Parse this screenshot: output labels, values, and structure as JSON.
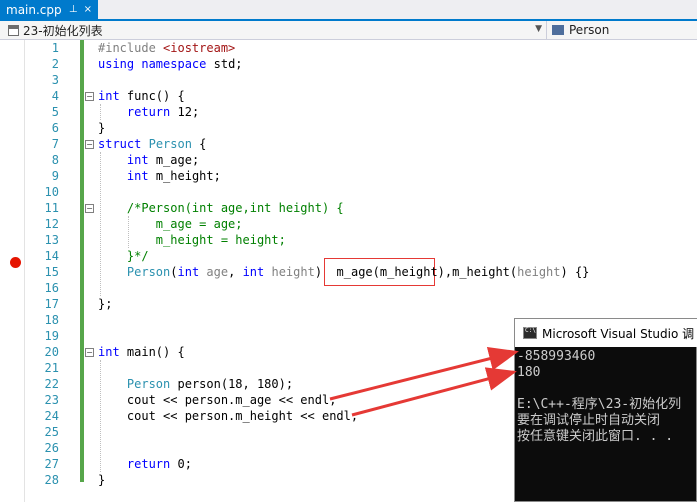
{
  "tab": {
    "title": "main.cpp",
    "pin_icon": "pin-icon",
    "close_glyph": "×"
  },
  "navbar": {
    "project": "23-初始化列表",
    "scope": "Person"
  },
  "code_lines": [
    {
      "n": "1",
      "html": "<span class=\"pp\">#include</span> <span class=\"str\">&lt;iostream&gt;</span>"
    },
    {
      "n": "2",
      "html": "<span class=\"kw\">using</span> <span class=\"kw\">namespace</span> std;"
    },
    {
      "n": "3",
      "html": ""
    },
    {
      "n": "4",
      "html": "<span class=\"kw\">int</span> func() {"
    },
    {
      "n": "5",
      "html": "    <span class=\"kw\">return</span> 12;"
    },
    {
      "n": "6",
      "html": "}"
    },
    {
      "n": "7",
      "html": "<span class=\"kw\">struct</span> <span class=\"ty\">Person</span> {"
    },
    {
      "n": "8",
      "html": "    <span class=\"kw\">int</span> m_age;"
    },
    {
      "n": "9",
      "html": "    <span class=\"kw\">int</span> m_height;"
    },
    {
      "n": "10",
      "html": ""
    },
    {
      "n": "11",
      "html": "    <span class=\"cm\">/*Person(int age,int height) {</span>"
    },
    {
      "n": "12",
      "html": "<span class=\"cm\">        m_age = age;</span>"
    },
    {
      "n": "13",
      "html": "<span class=\"cm\">        m_height = height;</span>"
    },
    {
      "n": "14",
      "html": "<span class=\"cm\">    }*/</span>"
    },
    {
      "n": "15",
      "html": "    <span class=\"ty\">Person</span>(<span class=\"kw\">int</span> <span class=\"pa\">age</span>, <span class=\"kw\">int</span> <span class=\"pa\">height</span>)  m_age(m_height),m_height(<span class=\"pa\">height</span>) {}"
    },
    {
      "n": "16",
      "html": ""
    },
    {
      "n": "17",
      "html": "};"
    },
    {
      "n": "18",
      "html": ""
    },
    {
      "n": "19",
      "html": ""
    },
    {
      "n": "20",
      "html": "<span class=\"kw\">int</span> main() {"
    },
    {
      "n": "21",
      "html": ""
    },
    {
      "n": "22",
      "html": "    <span class=\"ty\">Person</span> person(18, 180);"
    },
    {
      "n": "23",
      "html": "    cout &lt;&lt; person.m_age &lt;&lt; endl;"
    },
    {
      "n": "24",
      "html": "    cout &lt;&lt; person.m_height &lt;&lt; endl;"
    },
    {
      "n": "25",
      "html": ""
    },
    {
      "n": "26",
      "html": ""
    },
    {
      "n": "27",
      "html": "    <span class=\"kw\">return</span> 0;"
    },
    {
      "n": "28",
      "html": "}"
    }
  ],
  "folds": [
    "4",
    "7",
    "11",
    "20"
  ],
  "breakpoint_line": "12",
  "console": {
    "title": "Microsoft Visual Studio 调",
    "lines": [
      "-858993460",
      "180",
      "",
      "E:\\C++-程序\\23-初始化列",
      "要在调试停止时自动关闭",
      "按任意键关闭此窗口. . ."
    ]
  },
  "colors": {
    "accent": "#007acc",
    "annotation": "#e53935",
    "change_bar": "#57a64a",
    "breakpoint": "#e51400"
  }
}
